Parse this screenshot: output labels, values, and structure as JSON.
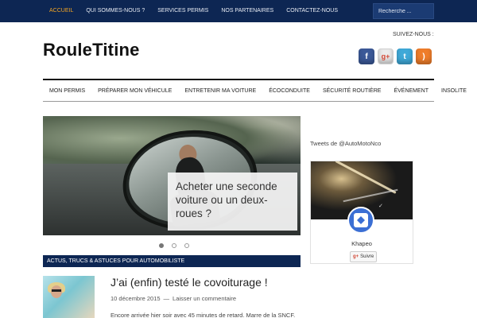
{
  "topbar": {
    "nav": [
      "ACCUEIL",
      "QUI SOMMES-NOUS ?",
      "SERVICES PERMIS",
      "NOS PARTENAIRES",
      "CONTACTEZ-NOUS"
    ],
    "active_index": 0,
    "search_placeholder": "Recherche ..."
  },
  "header": {
    "site_title": "RouleTitine",
    "follow_label": "SUIVEZ-NOUS :",
    "socials": [
      {
        "name": "facebook-icon",
        "glyph": "f"
      },
      {
        "name": "google-plus-icon",
        "glyph": "g+"
      },
      {
        "name": "twitter-icon",
        "glyph": "t"
      },
      {
        "name": "rss-icon",
        "glyph": ")"
      }
    ]
  },
  "main_nav": [
    "MON PERMIS",
    "PRÉPARER MON VÉHICULE",
    "ENTRETENIR MA VOITURE",
    "ÉCOCONDUITE",
    "SÉCURITÉ ROUTIÈRE",
    "ÉVÉNEMENT",
    "INSOLITE"
  ],
  "slider": {
    "caption": "Acheter une seconde voiture ou un deux-roues ?",
    "dot_count": 3,
    "active_dot": 0
  },
  "section": {
    "title": "ACTUS, TRUCS & ASTUCES POUR AUTOMOBILISTE"
  },
  "post": {
    "title": "J’ai (enfin) testé le covoiturage !",
    "date": "10 décembre 2015",
    "separator": "—",
    "comment_link": "Laisser un commentaire",
    "excerpt": "Encore arrivée hier soir avec 45 minutes de retard. Marre de la SNCF."
  },
  "sidebar": {
    "tweets_title": "Tweets de @AutoMotoNco",
    "card": {
      "name": "Khapeo",
      "follow_label": "Suivre",
      "follow_glyph": "g+",
      "verified_glyph": "✓"
    }
  },
  "colors": {
    "topbar": "#0d2653",
    "active_nav": "#f5a623"
  }
}
